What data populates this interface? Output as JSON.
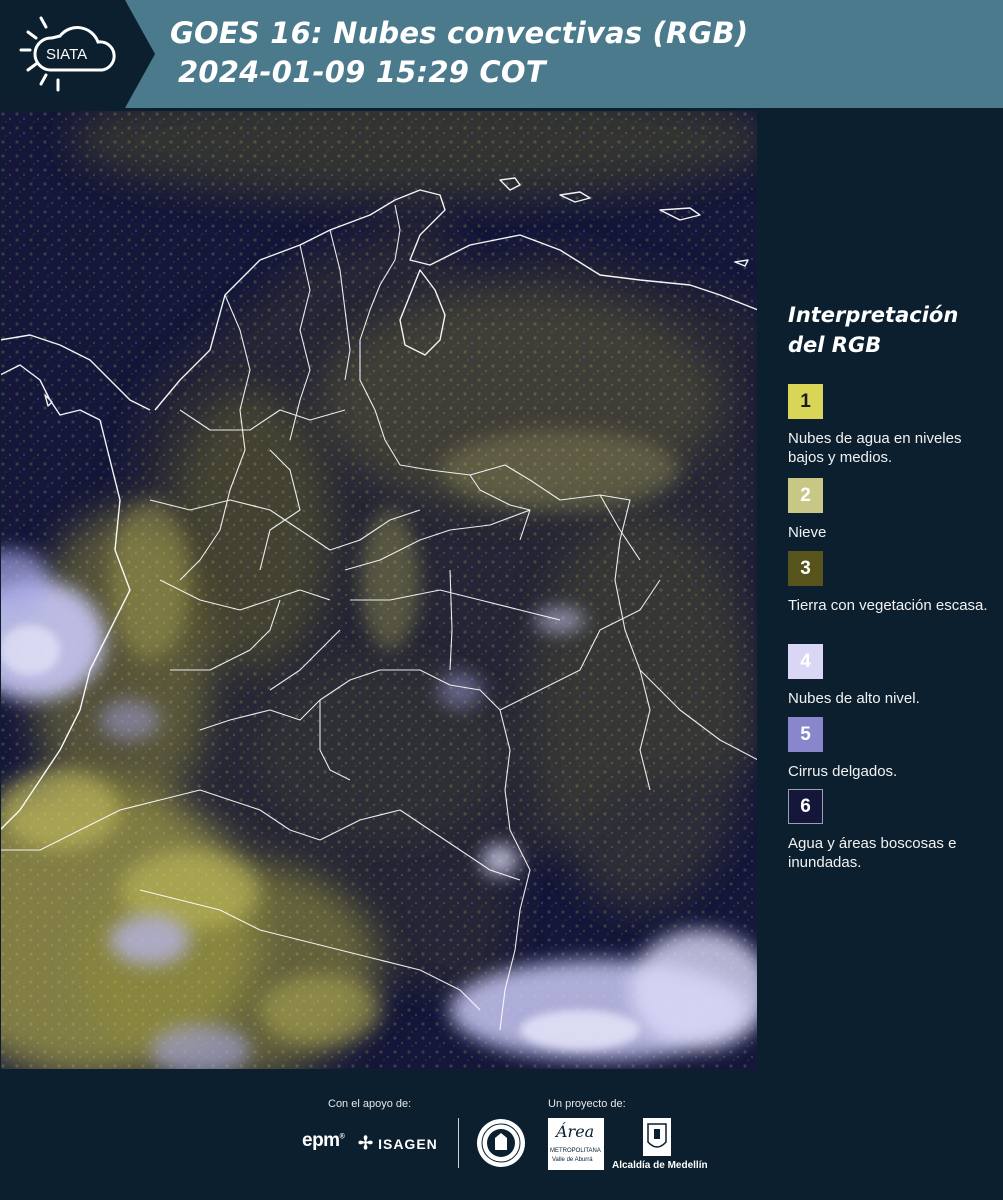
{
  "header": {
    "title_line1": "GOES 16: Nubes convectivas (RGB)",
    "title_line2": "2024-01-09 15:29 COT",
    "logo_text": "SIATA"
  },
  "legend": {
    "title": "Interpretación del RGB",
    "items": [
      {
        "number": "1",
        "label": "Nubes de agua en niveles bajos y medios.",
        "color": "#d9d556",
        "text_color": "#1a1a1a"
      },
      {
        "number": "2",
        "label": "Nieve",
        "color": "#c9c786",
        "text_color": "#ffffff"
      },
      {
        "number": "3",
        "label": "Tierra con vegetación escasa.",
        "color": "#56531c",
        "text_color": "#ffffff"
      },
      {
        "number": "4",
        "label": "Nubes de alto nivel.",
        "color": "#d9d7f5",
        "text_color": "#ffffff"
      },
      {
        "number": "5",
        "label": "Cirrus delgados.",
        "color": "#8a86cc",
        "text_color": "#ffffff"
      },
      {
        "number": "6",
        "label": "Agua y áreas boscosas e inundadas.",
        "color": "#14163a",
        "text_color": "#ffffff"
      }
    ]
  },
  "footer": {
    "support_label": "Con el apoyo de:",
    "project_label": "Un proyecto de:",
    "sponsor1": "epm",
    "sponsor2": "ISAGEN",
    "partner_area_line1": "Área",
    "partner_area_line2": "METROPOLITANA",
    "partner_area_line3": "Valle de Aburrá",
    "partner_alcaldia": "Alcaldía de Medellín"
  },
  "colors": {
    "header_bg": "#4a7a8c",
    "panel_bg": "#0b1f2e",
    "map_bg": "#14163a",
    "low_cloud": "#cfc964",
    "high_cloud": "#c8c8f5",
    "border_line": "#ffffff"
  }
}
